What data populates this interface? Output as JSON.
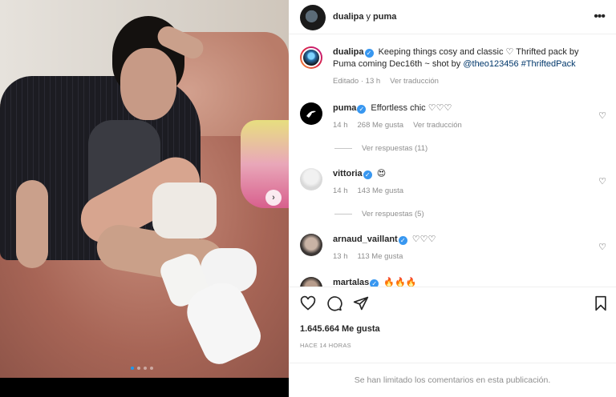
{
  "post": {
    "owners": {
      "first": "dualipa",
      "joiner": "y",
      "second": "puma"
    },
    "more_icon": "ellipsis-icon",
    "carousel": {
      "slide_count": 4,
      "active_index": 0,
      "next_icon": "chevron-right-icon"
    }
  },
  "caption": {
    "username": "dualipa",
    "text": "Keeping things cosy and classic ♡ Thrifted pack by Puma coming Dec16th ~ shot by ",
    "mention": "@theo123456",
    "hashtag": "#ThriftedPack",
    "edited": "Editado · 13 h",
    "translate": "Ver traducción"
  },
  "comments": [
    {
      "username": "puma",
      "text": "Effortless chic ♡♡♡",
      "time": "14 h",
      "likes": "268 Me gusta",
      "translate": "Ver traducción",
      "replies": "Ver respuestas (11)"
    },
    {
      "username": "vittoria",
      "text": "😍",
      "time": "14 h",
      "likes": "143 Me gusta",
      "replies": "Ver respuestas (5)"
    },
    {
      "username": "arnaud_vaillant",
      "text": "♡♡♡",
      "time": "13 h",
      "likes": "113 Me gusta"
    },
    {
      "username": "martalas",
      "text": "🔥🔥🔥"
    }
  ],
  "actions": {
    "likes": "1.645.664 Me gusta",
    "posted": "HACE 14 HORAS",
    "limited": "Se han limitado los comentarios en esta publicación.",
    "icons": [
      "heart-icon",
      "comment-icon",
      "share-icon",
      "bookmark-icon"
    ]
  },
  "colors": {
    "verified": "#3897f0",
    "text": "#262626",
    "muted": "#8e8e8e",
    "carousel_active": "#1d9bf0"
  }
}
